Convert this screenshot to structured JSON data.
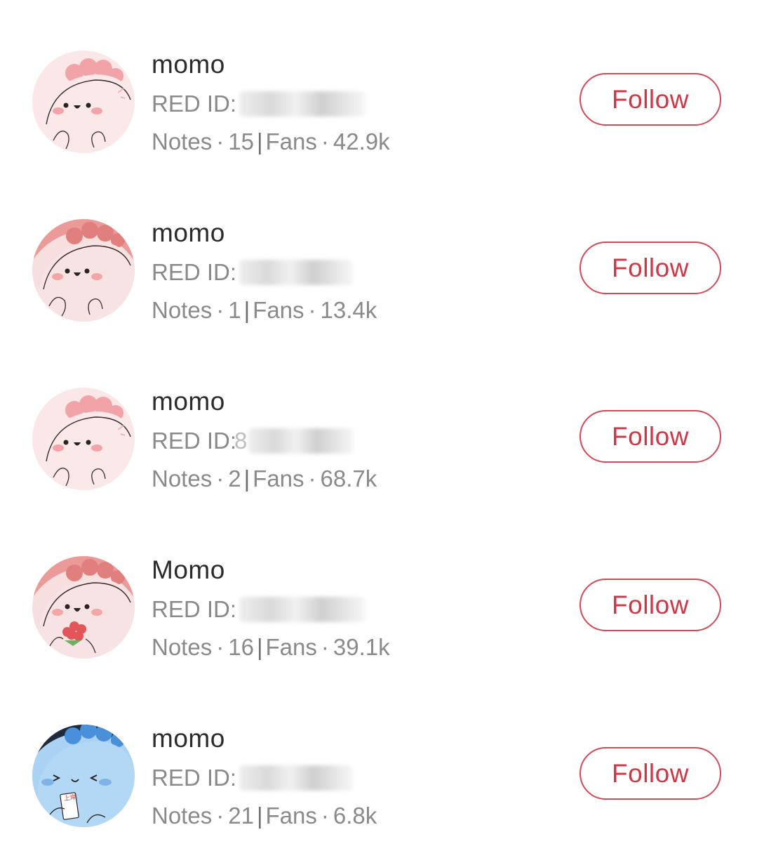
{
  "users": [
    {
      "name": "momo",
      "red_id_label": "RED ID:",
      "red_id_value": "",
      "notes_label": "Notes",
      "notes_count": "15",
      "fans_label": "Fans",
      "fans_count": "42.9k",
      "follow_label": "Follow",
      "avatar_icon": "pink-dino-avatar-icon"
    },
    {
      "name": "momo",
      "red_id_label": "RED ID:",
      "red_id_value": "",
      "notes_label": "Notes",
      "notes_count": "1",
      "fans_label": "Fans",
      "fans_count": "13.4k",
      "follow_label": "Follow",
      "avatar_icon": "pink-dino-avatar-icon"
    },
    {
      "name": "momo",
      "red_id_label": "RED ID:",
      "red_id_value": "8",
      "notes_label": "Notes",
      "notes_count": "2",
      "fans_label": "Fans",
      "fans_count": "68.7k",
      "follow_label": "Follow",
      "avatar_icon": "pink-dino-avatar-icon"
    },
    {
      "name": "Momo",
      "red_id_label": "RED ID:",
      "red_id_value": "",
      "notes_label": "Notes",
      "notes_count": "16",
      "fans_label": "Fans",
      "fans_count": "39.1k",
      "follow_label": "Follow",
      "avatar_icon": "pink-dino-flower-avatar-icon"
    },
    {
      "name": "momo",
      "red_id_label": "RED ID:",
      "red_id_value": "",
      "notes_label": "Notes",
      "notes_count": "21",
      "fans_label": "Fans",
      "fans_count": "6.8k",
      "follow_label": "Follow",
      "avatar_icon": "blue-dino-avatar-icon",
      "avatar_sign_text": "上岸"
    }
  ],
  "stat_separator": "·",
  "stat_divider": "|",
  "colors": {
    "follow_accent": "#d03645",
    "follow_border": "#d34a57",
    "name_text": "#2b2b2b",
    "meta_text": "#8a8a8a",
    "avatar_pink_bg": "#fbe4e6",
    "avatar_blue_bg": "#a9d2f3"
  }
}
